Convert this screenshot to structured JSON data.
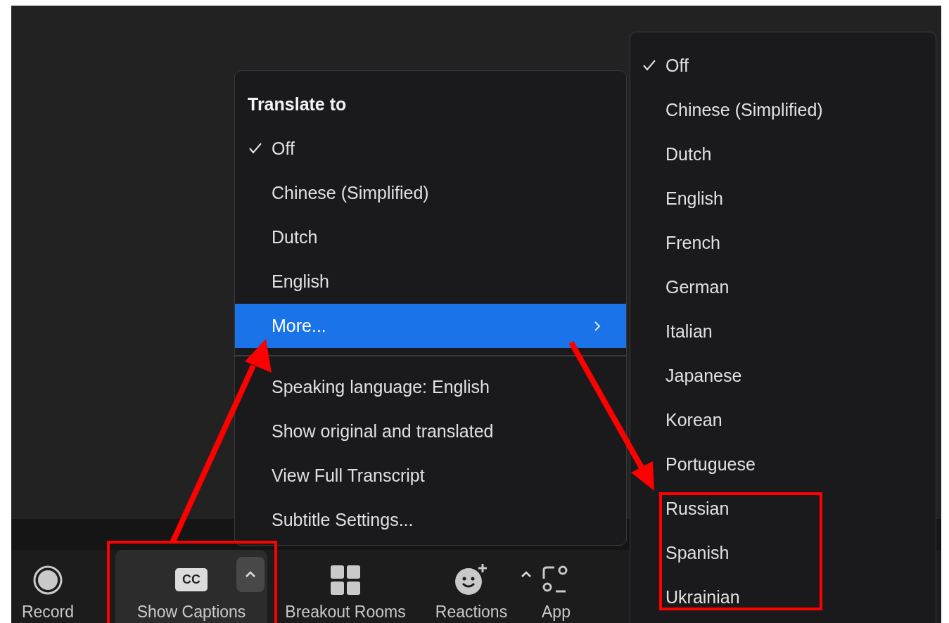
{
  "translate_menu": {
    "title": "Translate to",
    "items": [
      {
        "label": "Off",
        "checked": true,
        "highlighted": false,
        "submenu": false
      },
      {
        "label": "Chinese (Simplified)",
        "checked": false,
        "highlighted": false,
        "submenu": false
      },
      {
        "label": "Dutch",
        "checked": false,
        "highlighted": false,
        "submenu": false
      },
      {
        "label": "English",
        "checked": false,
        "highlighted": false,
        "submenu": false
      },
      {
        "label": "More...",
        "checked": false,
        "highlighted": true,
        "submenu": true
      }
    ],
    "actions": [
      {
        "label": "Speaking language: English"
      },
      {
        "label": "Show original and translated"
      },
      {
        "label": "View Full Transcript"
      },
      {
        "label": "Subtitle Settings..."
      }
    ]
  },
  "language_submenu": {
    "items": [
      {
        "label": "Off",
        "checked": true
      },
      {
        "label": "Chinese (Simplified)",
        "checked": false
      },
      {
        "label": "Dutch",
        "checked": false
      },
      {
        "label": "English",
        "checked": false
      },
      {
        "label": "French",
        "checked": false
      },
      {
        "label": "German",
        "checked": false
      },
      {
        "label": "Italian",
        "checked": false
      },
      {
        "label": "Japanese",
        "checked": false
      },
      {
        "label": "Korean",
        "checked": false
      },
      {
        "label": "Portuguese",
        "checked": false
      },
      {
        "label": "Russian",
        "checked": false
      },
      {
        "label": "Spanish",
        "checked": false
      },
      {
        "label": "Ukrainian",
        "checked": false
      }
    ]
  },
  "toolbar": {
    "items": [
      {
        "kind": "record",
        "label": "Record",
        "active": false
      },
      {
        "kind": "captions",
        "label": "Show Captions",
        "badge": "CC",
        "active": true
      },
      {
        "kind": "breakout",
        "label": "Breakout Rooms",
        "active": false
      },
      {
        "kind": "reactions",
        "label": "Reactions",
        "active": false
      },
      {
        "kind": "apps",
        "label": "App",
        "active": false
      }
    ]
  }
}
